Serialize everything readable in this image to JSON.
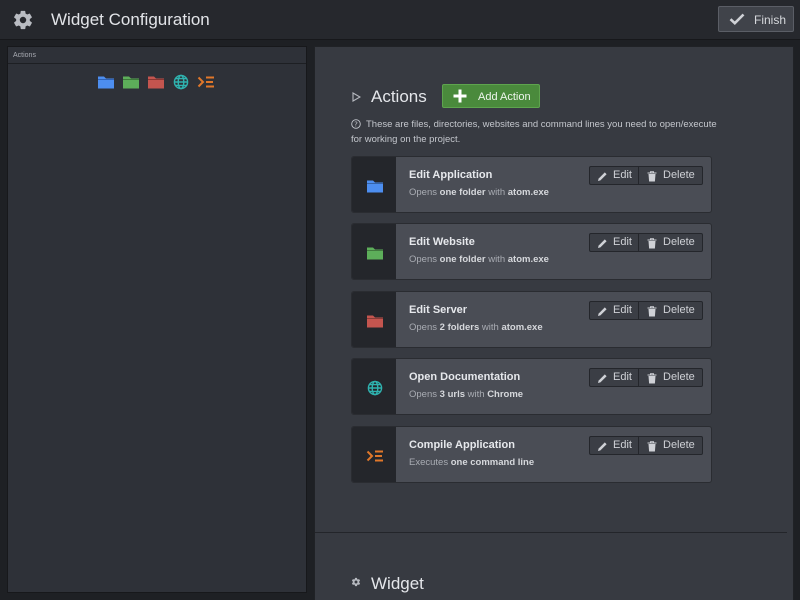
{
  "header": {
    "title": "Widget Configuration",
    "settings_icon": "gear-icon",
    "finish_label": "Finish",
    "finish_icon": "checkmark-icon"
  },
  "left_panel": {
    "heading": "Actions",
    "palette": [
      {
        "name": "blue-folder-icon",
        "color": "#4d8ef0"
      },
      {
        "name": "green-folder-icon",
        "color": "#5dae5a"
      },
      {
        "name": "red-folder-icon",
        "color": "#c4554f"
      },
      {
        "name": "globe-icon",
        "color": "#2fb3b0"
      },
      {
        "name": "command-line-icon",
        "color": "#e0772a"
      }
    ]
  },
  "actions_section": {
    "title": "Actions",
    "add_label": "Add Action",
    "help_text": "These are files, directories, websites and command lines you need to open/execute for working on the project.",
    "items": [
      {
        "title": "Edit Application",
        "desc_pre": "Opens ",
        "desc_bold": "one folder",
        "desc_mid": " with ",
        "desc_tool": "atom.exe",
        "icon": "blue-folder-icon",
        "color": "#4d8ef0"
      },
      {
        "title": "Edit Website",
        "desc_pre": "Opens ",
        "desc_bold": "one folder",
        "desc_mid": " with ",
        "desc_tool": "atom.exe",
        "icon": "green-folder-icon",
        "color": "#5dae5a"
      },
      {
        "title": "Edit Server",
        "desc_pre": "Opens ",
        "desc_bold": "2 folders",
        "desc_mid": " with ",
        "desc_tool": "atom.exe",
        "icon": "red-folder-icon",
        "color": "#c4554f"
      },
      {
        "title": "Open Documentation",
        "desc_pre": "Opens ",
        "desc_bold": "3 urls",
        "desc_mid": " with ",
        "desc_tool": "Chrome",
        "icon": "globe-icon",
        "color": "#2fb3b0"
      },
      {
        "title": "Compile Application",
        "desc_pre": "Executes ",
        "desc_bold": "one command line",
        "desc_mid": "",
        "desc_tool": "",
        "icon": "command-line-icon",
        "color": "#e0772a"
      }
    ],
    "edit_label": "Edit",
    "delete_label": "Delete"
  },
  "widget_section": {
    "title": "Widget"
  },
  "colors": {
    "accent_green": "#4a8a3c",
    "background": "#1e2024"
  }
}
